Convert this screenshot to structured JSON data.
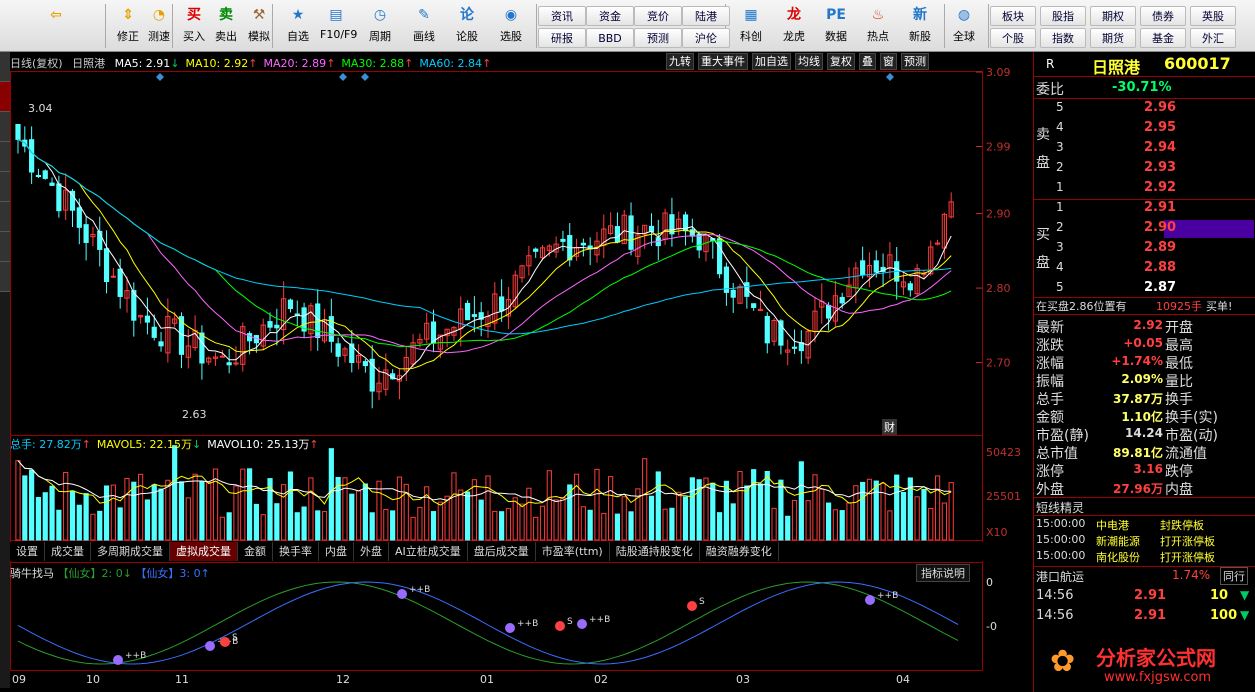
{
  "toolbar": {
    "buttons": [
      {
        "label": "",
        "icon": "back-arrow-icon"
      },
      {
        "label": "修正",
        "icon": "up-down-arrows-icon"
      },
      {
        "label": "测速",
        "icon": "clock-icon"
      },
      {
        "label": "买入",
        "icon": "buy-icon"
      },
      {
        "label": "卖出",
        "icon": "sell-icon"
      },
      {
        "label": "模拟",
        "icon": "hammer-icon"
      },
      {
        "label": "自选",
        "icon": "star-icon"
      },
      {
        "label": "F10/F9",
        "icon": "f10-icon"
      },
      {
        "label": "周期",
        "icon": "period-icon"
      },
      {
        "label": "画线",
        "icon": "pen-icon"
      },
      {
        "label": "论股",
        "icon": "lun-icon"
      },
      {
        "label": "选股",
        "icon": "select-stock-icon"
      }
    ],
    "links": [
      [
        "资讯",
        "资金",
        "竞价",
        "陆港"
      ],
      [
        "研报",
        "BBD",
        "预测",
        "沪伦"
      ]
    ],
    "buttons2": [
      {
        "label": "科创",
        "icon": "kechuang-icon"
      },
      {
        "label": "龙虎",
        "icon": "longhu-icon"
      },
      {
        "label": "数据",
        "icon": "pe-icon"
      },
      {
        "label": "热点",
        "icon": "fire-icon"
      },
      {
        "label": "新股",
        "icon": "newstock-icon"
      },
      {
        "label": "全球",
        "icon": "globe-icon"
      }
    ],
    "links2": [
      [
        "板块",
        "股指",
        "期权",
        "债券",
        "英股"
      ],
      [
        "个股",
        "指数",
        "期货",
        "基金",
        "外汇"
      ]
    ]
  },
  "kline": {
    "period": "日线(复权)",
    "name": "日照港",
    "ma": [
      {
        "label": "MA5: 2.91",
        "arrow": "↓",
        "color": "#ffffff"
      },
      {
        "label": "MA10: 2.92",
        "arrow": "↑",
        "color": "#ffff00"
      },
      {
        "label": "MA20: 2.89",
        "arrow": "↑",
        "color": "#ff66ff"
      },
      {
        "label": "MA30: 2.88",
        "arrow": "↑",
        "color": "#00ff00"
      },
      {
        "label": "MA60: 2.84",
        "arrow": "↑",
        "color": "#00ccff"
      }
    ],
    "buttons": [
      "九转",
      "重大事件",
      "加自选",
      "均线",
      "复权",
      "叠",
      "窗",
      "预测"
    ],
    "y_ticks": [
      "3.09",
      "2.99",
      "2.90",
      "2.80",
      "2.70"
    ],
    "high_label": "3.04",
    "low_label": "2.63",
    "cai": "财"
  },
  "volume": {
    "head": [
      {
        "label": "总手: 27.82万",
        "arrow": "↑",
        "color": "#00ccff"
      },
      {
        "label": "MAVOL5: 22.15万",
        "arrow": "↓",
        "color": "#ffff00"
      },
      {
        "label": "MAVOL10: 25.13万",
        "arrow": "↑",
        "color": "#ffffff"
      }
    ],
    "y_ticks": [
      "50423",
      "25501",
      "X10"
    ]
  },
  "tabs": [
    "设置",
    "成交量",
    "多周期成交量",
    "虚拟成交量",
    "金额",
    "换手率",
    "内盘",
    "外盘",
    "AI立桩成交量",
    "盘后成交量",
    "市盈率(ttm)",
    "陆股通持股变化",
    "融资融券变化"
  ],
  "tabs_active": 3,
  "indicator": {
    "name": "骑牛找马",
    "s1": "【仙女】2: 0",
    "a1": "↓",
    "s2": "【仙女】3: 0",
    "a2": "↑",
    "button": "指标说明",
    "y_ticks": [
      "0",
      "-0"
    ],
    "labels": [
      "++B",
      "++B",
      "S",
      "++B",
      "++B",
      "S",
      "++B",
      "S",
      "++B"
    ]
  },
  "xaxis": [
    "09",
    "10",
    "11",
    "12",
    "01",
    "02",
    "03",
    "04"
  ],
  "quote": {
    "r": "R",
    "name": "日照港",
    "code": "600017",
    "weibi_label": "委比",
    "weibi": "-30.71%",
    "sell_label": [
      "卖",
      "盘"
    ],
    "buy_label": [
      "买",
      "盘"
    ],
    "sell": [
      {
        "lv": "5",
        "p": "2.96"
      },
      {
        "lv": "4",
        "p": "2.95"
      },
      {
        "lv": "3",
        "p": "2.94"
      },
      {
        "lv": "2",
        "p": "2.93"
      },
      {
        "lv": "1",
        "p": "2.92"
      }
    ],
    "buy": [
      {
        "lv": "1",
        "p": "2.91"
      },
      {
        "lv": "2",
        "p": "2.90"
      },
      {
        "lv": "3",
        "p": "2.89"
      },
      {
        "lv": "4",
        "p": "2.88"
      },
      {
        "lv": "5",
        "p": "2.87"
      }
    ],
    "note": "在买盘2.86位置有",
    "note_vol": "10925手",
    "note_btn": "买单!",
    "stats": [
      {
        "k": "最新",
        "v": "2.92",
        "k2": "开盘",
        "c": "#ff4040"
      },
      {
        "k": "涨跌",
        "v": "+0.05",
        "k2": "最高",
        "c": "#ff4040"
      },
      {
        "k": "涨幅",
        "v": "+1.74%",
        "k2": "最低",
        "c": "#ff4040"
      },
      {
        "k": "振幅",
        "v": "2.09%",
        "k2": "量比",
        "c": "#ffff66"
      },
      {
        "k": "总手",
        "v": "37.87万",
        "k2": "换手",
        "c": "#ffff66"
      },
      {
        "k": "金额",
        "v": "1.10亿",
        "k2": "换手(实)",
        "c": "#ffff66"
      },
      {
        "k": "市盈(静)",
        "v": "14.24",
        "k2": "市盈(动)",
        "c": "#dddddd"
      },
      {
        "k": "总市值",
        "v": "89.81亿",
        "k2": "流通值",
        "c": "#ffff66"
      },
      {
        "k": "涨停",
        "v": "3.16",
        "k2": "跌停",
        "c": "#ff4040"
      },
      {
        "k": "外盘",
        "v": "27.96万",
        "k2": "内盘",
        "c": "#ff4040"
      }
    ],
    "elves_title": "短线精灵",
    "elves": [
      {
        "t": "15:00:00",
        "n": "中电港",
        "e": "封跌停板"
      },
      {
        "t": "15:00:00",
        "n": "新潮能源",
        "e": "打开涨停板"
      },
      {
        "t": "15:00:00",
        "n": "南化股份",
        "e": "打开涨停板"
      }
    ],
    "port_name": "港口航运",
    "port_pct": "1.74%",
    "port_btn": "同行",
    "ticks": [
      {
        "t": "14:56",
        "p": "2.91",
        "v": "10"
      },
      {
        "t": "14:56",
        "p": "2.91",
        "v": "100"
      }
    ]
  },
  "watermark": {
    "text": "分析家公式网",
    "url": "www.fxjgsw.com"
  }
}
